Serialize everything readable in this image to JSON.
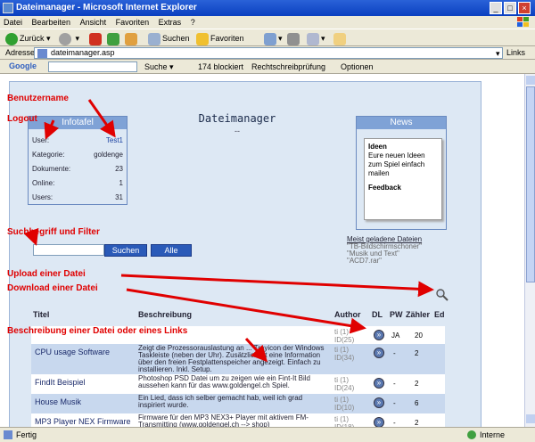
{
  "window": {
    "title": "Dateimanager - Microsoft Internet Explorer"
  },
  "menu": [
    "Datei",
    "Bearbeiten",
    "Ansicht",
    "Favoriten",
    "Extras",
    "?"
  ],
  "toolbar": {
    "back": "Zurück",
    "search": "Suchen",
    "favorites": "Favoriten"
  },
  "address": {
    "label": "Adresse",
    "url": "dateimanager.asp",
    "links": "Links"
  },
  "google": {
    "label": "Google",
    "search": "Suche",
    "blocked": "174 blockiert",
    "spell": "Rechtschreibprüfung",
    "options": "Optionen"
  },
  "page": {
    "heading": "Dateimanager",
    "heading_sub": "--",
    "infotafel": {
      "title": "Infotafel",
      "rows": [
        {
          "label": "User:",
          "value": "Test1"
        },
        {
          "label": "Kategorie:",
          "value": "goldenge"
        },
        {
          "label": "Dokumente:",
          "value": "23"
        },
        {
          "label": "Online:",
          "value": "1"
        },
        {
          "label": "Users:",
          "value": "31"
        }
      ]
    },
    "news": {
      "title": "News",
      "item_title": "Ideen",
      "item_text": "Eure neuen Ideen zum Spiel einfach mailen",
      "item_more": "Feedback"
    },
    "search": {
      "value": "",
      "btn_search": "Suchen",
      "btn_all": "Alle"
    },
    "popular": {
      "title": "Meist geladene Dateien",
      "items": [
        "\"TB-Bildschirmschoner\"",
        "\"Musik und Text\"",
        "\"ACD7.rar\""
      ]
    },
    "table": {
      "headers": [
        "Titel",
        "Beschreibung",
        "Author",
        "DL",
        "PW",
        "Zähler",
        "Ed"
      ],
      "rows": [
        {
          "title": "",
          "desc": "",
          "author": "ti (1)\nID(25)",
          "pw": "JA",
          "count": "20"
        },
        {
          "title": "CPU usage Software",
          "desc": "Zeigt die Prozessorauslastung an ... Trayicon der Windows Taskleiste (neben der Uhr). Zusätzlich ist eine Information über den freien Festplattenspeicher angezeigt. Einfach zu installieren. Inkl. Setup.",
          "author": "ti (1)\nID(34)",
          "pw": "-",
          "count": "2"
        },
        {
          "title": "FindIt Beispiel",
          "desc": "Photoshop PSD Datei um zu zeigen wie ein Fint-It Bild aussehen kann für das www.goldengel.ch Spiel.",
          "author": "ti (1)\nID(24)",
          "pw": "-",
          "count": "2"
        },
        {
          "title": "House Musik",
          "desc": "Ein Lied, dass ich selber gemacht hab, weil ich grad inspiriert wurde.",
          "author": "ti (1)\nID(10)",
          "pw": "-",
          "count": "6"
        },
        {
          "title": "MP3 Player NEX Firmware",
          "desc": "Firmware für den MP3 NEX3+ Player mit aktivem FM-Transmitting (www.goldengel.ch --> shop)",
          "author": "ti (1)\nID(18)",
          "pw": "-",
          "count": "2"
        }
      ]
    }
  },
  "annotations": {
    "user": "Benutzername",
    "logout": "Logout",
    "search": "Suchbegriff und Filter",
    "upload": "Upload einer Datei",
    "download": "Download einer Datei",
    "describe": "Beschreibung einer Datei oder eines Links"
  },
  "status": {
    "left": "Fertig",
    "zone": "Interne"
  }
}
